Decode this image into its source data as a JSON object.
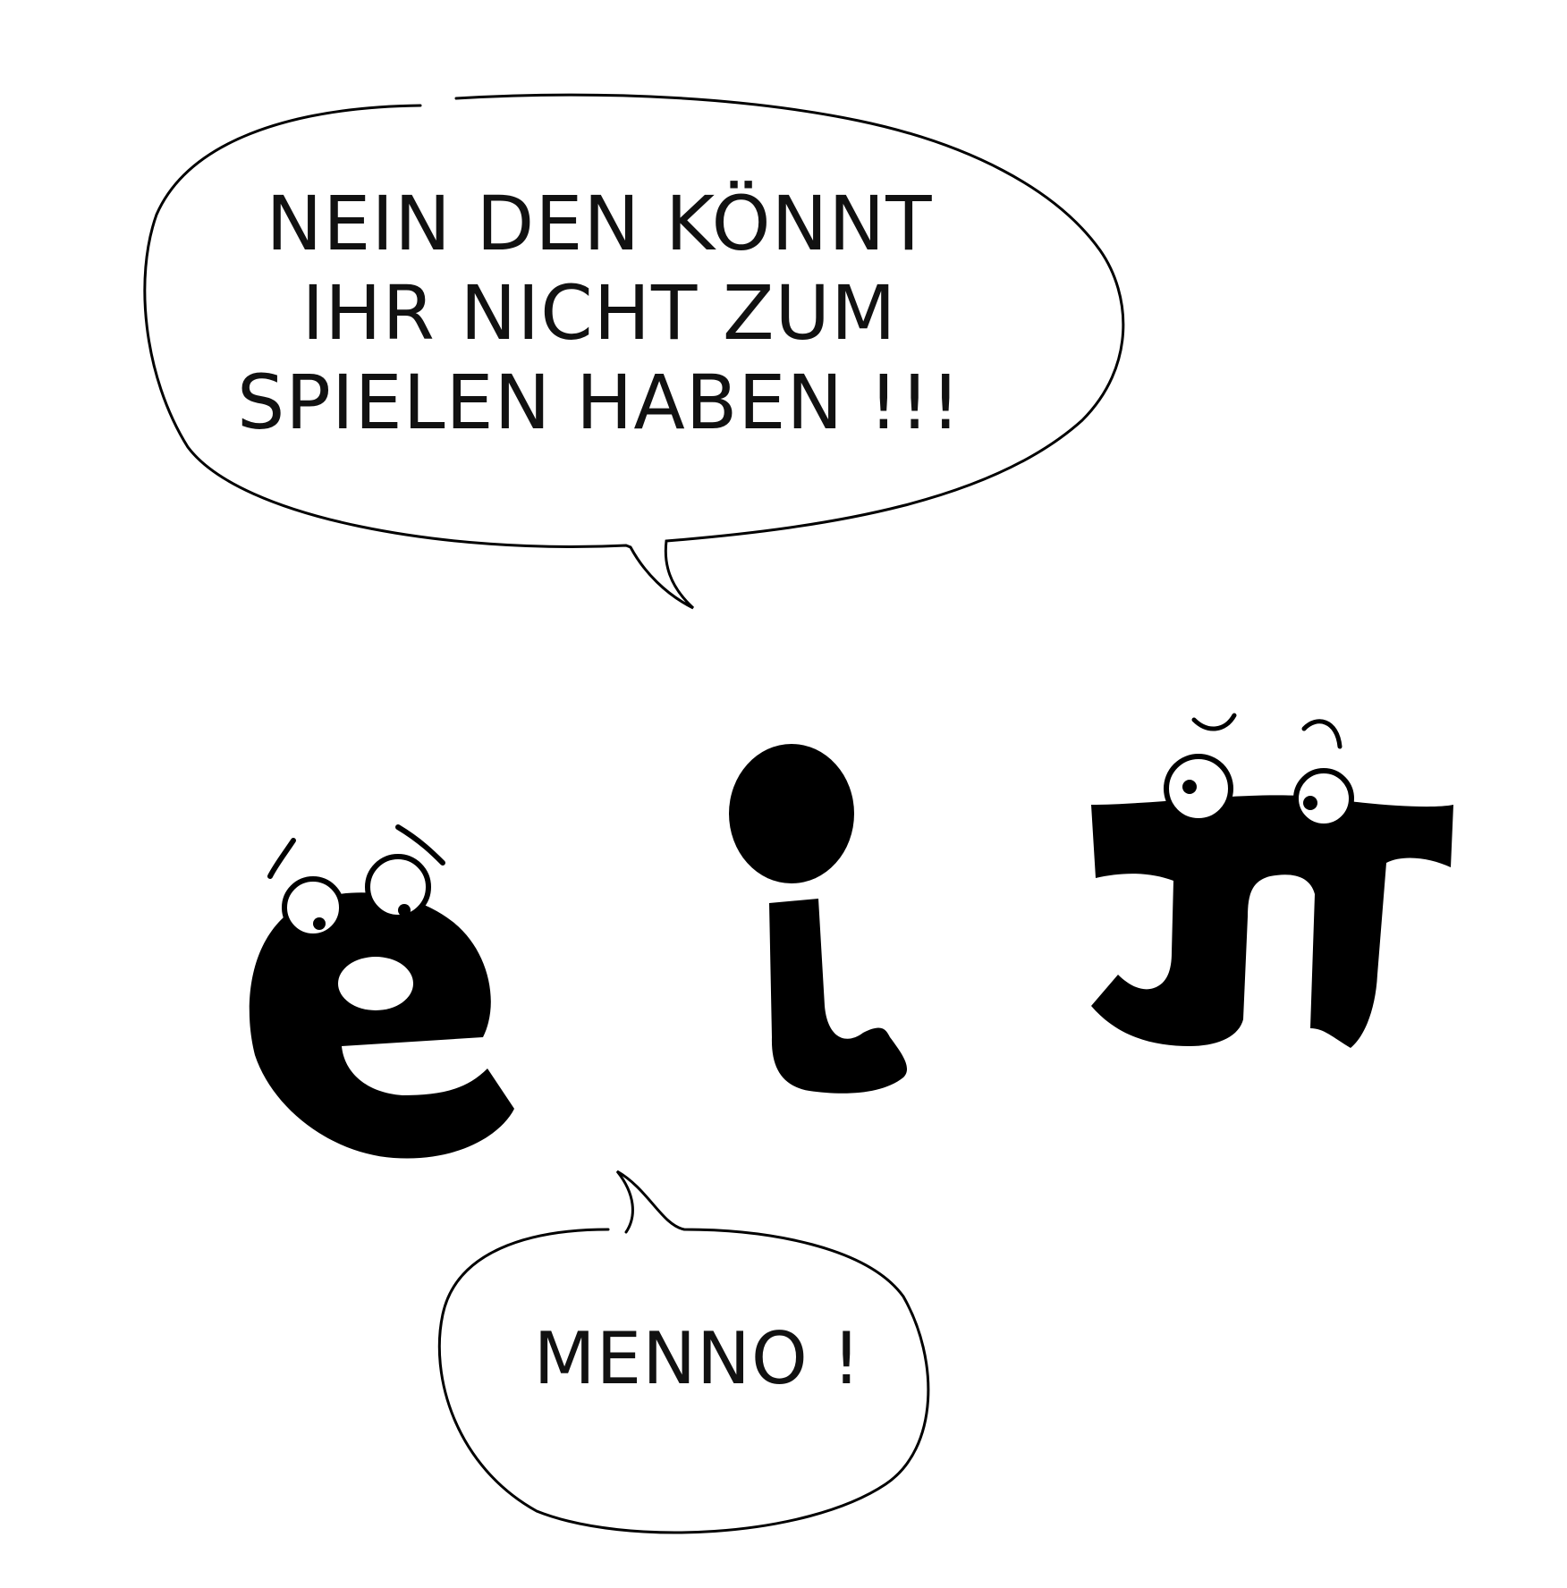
{
  "scene": {
    "ink_color": "#000000",
    "paper_color": "#ffffff"
  },
  "speech_bubble_top": {
    "lines": [
      "NEIN DEN KÖNNT",
      "IHR NICHT ZUM",
      "SPIELEN HABEN !!!"
    ]
  },
  "speech_bubble_bottom": {
    "text": "MENNO !"
  },
  "characters": [
    {
      "id": "letter-e",
      "glyph": "e",
      "expression": "worried"
    },
    {
      "id": "letter-i",
      "glyph": "i",
      "expression": "none"
    },
    {
      "id": "letter-n",
      "glyph": "n",
      "expression": "surprised"
    }
  ]
}
